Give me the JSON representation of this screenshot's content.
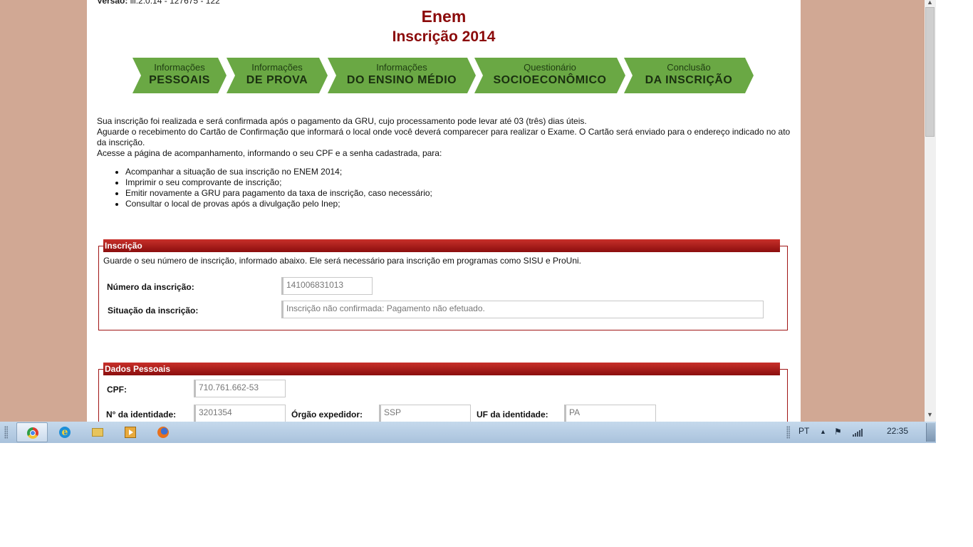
{
  "page": {
    "version_label": "Versão:",
    "version_value": "lll.2.0.14 - 127675 - 122",
    "title": "Enem",
    "subtitle": "Inscrição 2014"
  },
  "steps": [
    {
      "line1": "Informações",
      "line2": "PESSOAIS"
    },
    {
      "line1": "Informações",
      "line2": "DE PROVA"
    },
    {
      "line1": "Informações",
      "line2": "DO ENSINO MÉDIO"
    },
    {
      "line1": "Questionário",
      "line2": "SOCIOECONÔMICO"
    },
    {
      "line1": "Conclusão",
      "line2": "DA INSCRIÇÃO"
    }
  ],
  "intro": {
    "p1": "Sua inscrição foi realizada e será confirmada após o pagamento da GRU, cujo processamento pode levar até 03 (três) dias úteis.",
    "p2": "Aguarde o recebimento do Cartão de Confirmação que informará o local onde você deverá comparecer para realizar o Exame. O Cartão será enviado para o endereço indicado no ato da inscrição.",
    "p3": "Acesse a página de acompanhamento, informando o seu CPF e a senha cadastrada, para:",
    "bullets": [
      "Acompanhar a situação de sua inscrição no ENEM 2014;",
      "Imprimir o seu comprovante de inscrição;",
      "Emitir novamente a GRU para pagamento da taxa de inscrição, caso necessário;",
      "Consultar o local de provas após a divulgação pelo Inep;"
    ]
  },
  "inscricao": {
    "heading": "Inscrição",
    "note": "Guarde o seu número de inscrição, informado abaixo. Ele será necessário para inscrição em programas como SISU e ProUni.",
    "numero_label": "Número da inscrição:",
    "numero_value": "141006831013",
    "situacao_label": "Situação da inscrição:",
    "situacao_value": "Inscrição não confirmada: Pagamento não efetuado."
  },
  "dados_pessoais": {
    "heading": "Dados Pessoais",
    "cpf_label": "CPF:",
    "cpf_value": "710.761.662-53",
    "identidade_label": "N° da identidade:",
    "identidade_value": "3201354",
    "orgao_label": "Órgão expedidor:",
    "orgao_value": "SSP",
    "uf_label": "UF da identidade:",
    "uf_value": "PA"
  },
  "taskbar": {
    "language": "PT",
    "clock": "22:35",
    "apps": [
      "chrome-icon",
      "internet-explorer-icon",
      "file-explorer-icon",
      "media-player-icon",
      "firefox-icon"
    ]
  },
  "colors": {
    "title_red": "#8b0a0a",
    "step_green": "#6aa844",
    "panel_red": "#a01515",
    "side_background": "#d1a894"
  }
}
